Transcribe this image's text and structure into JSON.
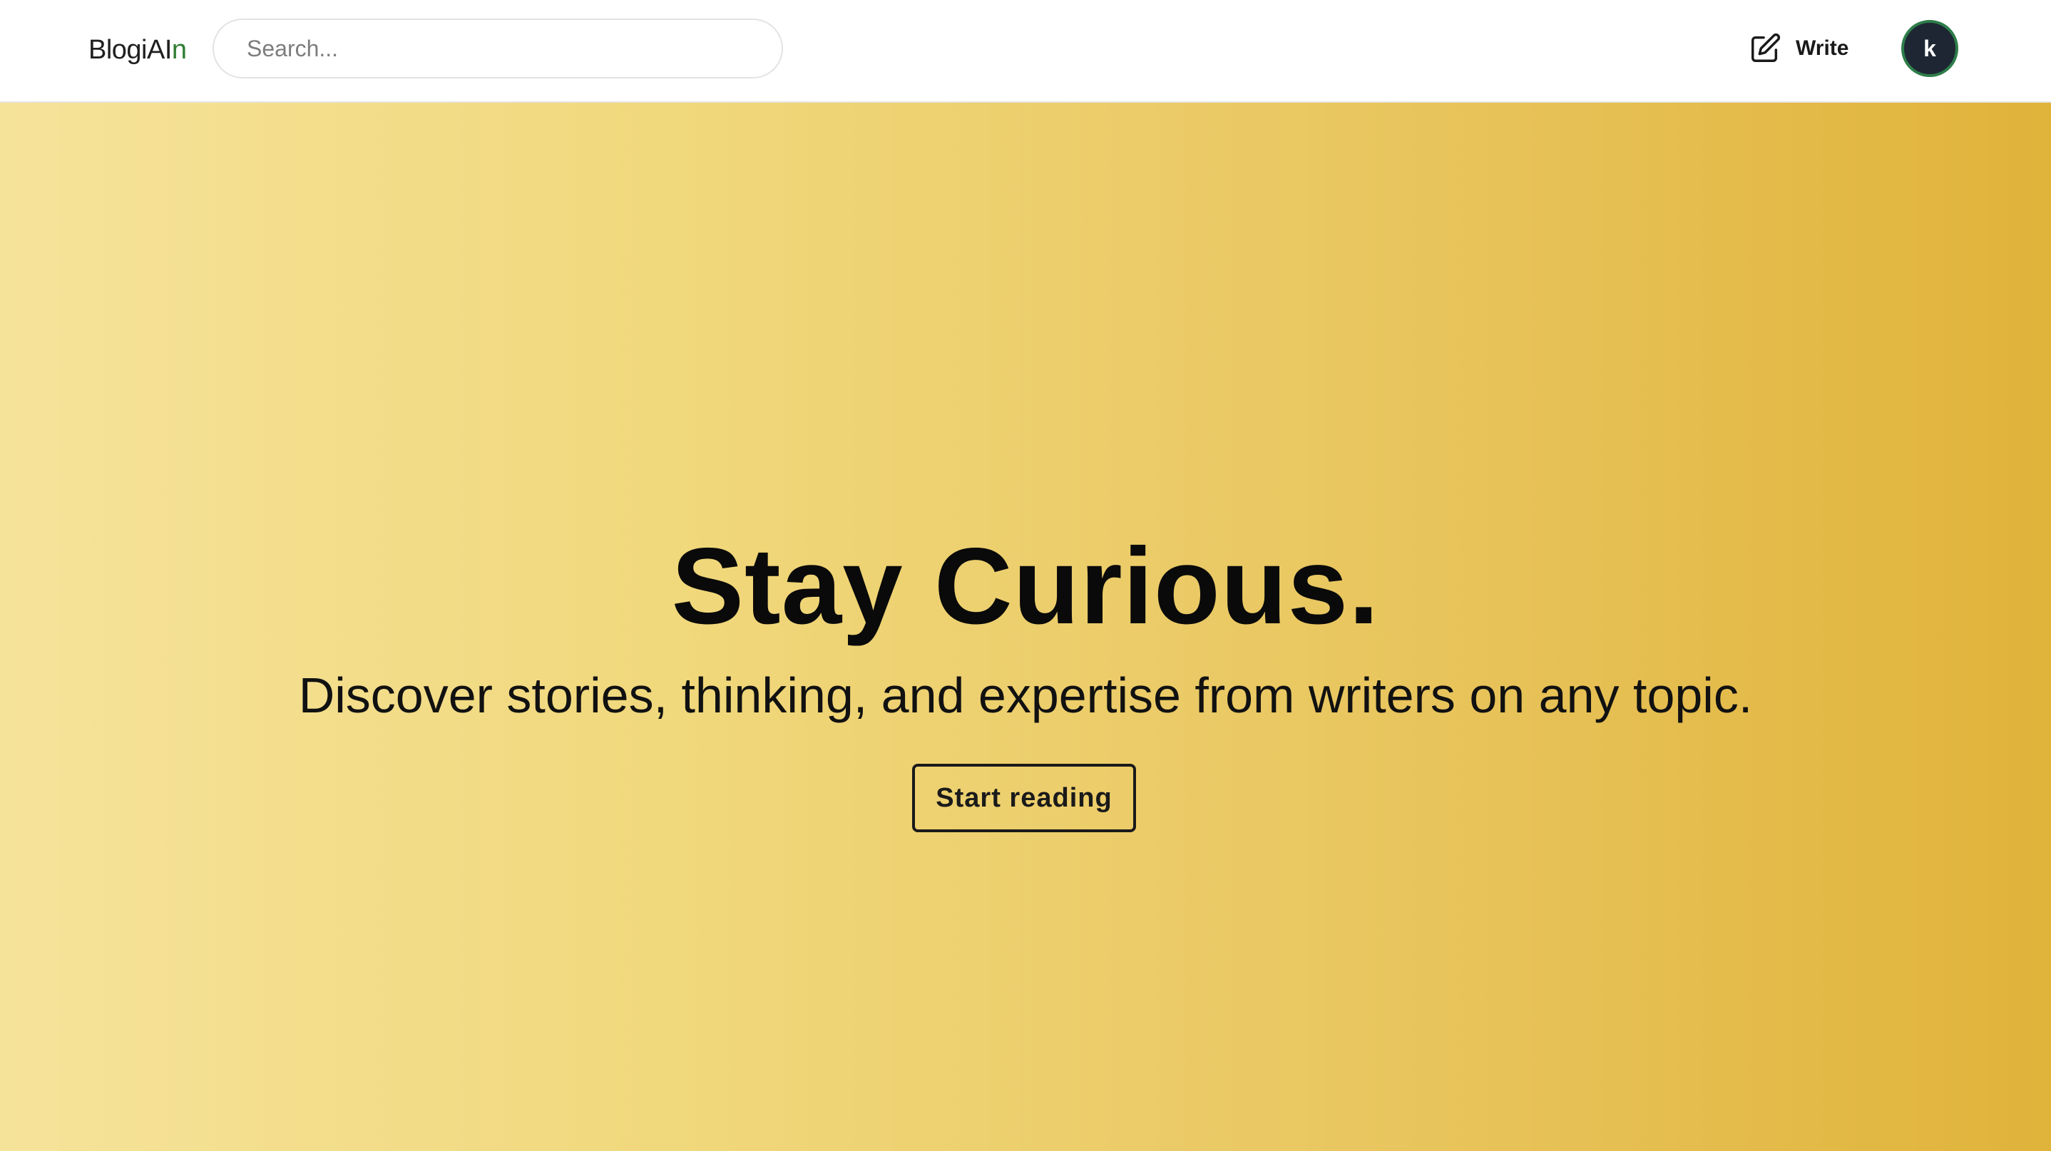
{
  "header": {
    "logo": {
      "text_main": "BlogiAI",
      "text_accent": "n"
    },
    "search": {
      "placeholder": "Search...",
      "value": ""
    },
    "write": {
      "label": "Write",
      "icon": "pencil-square-icon"
    },
    "avatar": {
      "letter": "k",
      "background": "#1e2633",
      "ring": "#2e7d4a"
    }
  },
  "hero": {
    "title": "Stay Curious.",
    "subtitle": "Discover stories, thinking, and expertise from writers on any topic.",
    "cta_label": "Start reading",
    "gradient": [
      "#f6e39a",
      "#e0b33a"
    ]
  }
}
